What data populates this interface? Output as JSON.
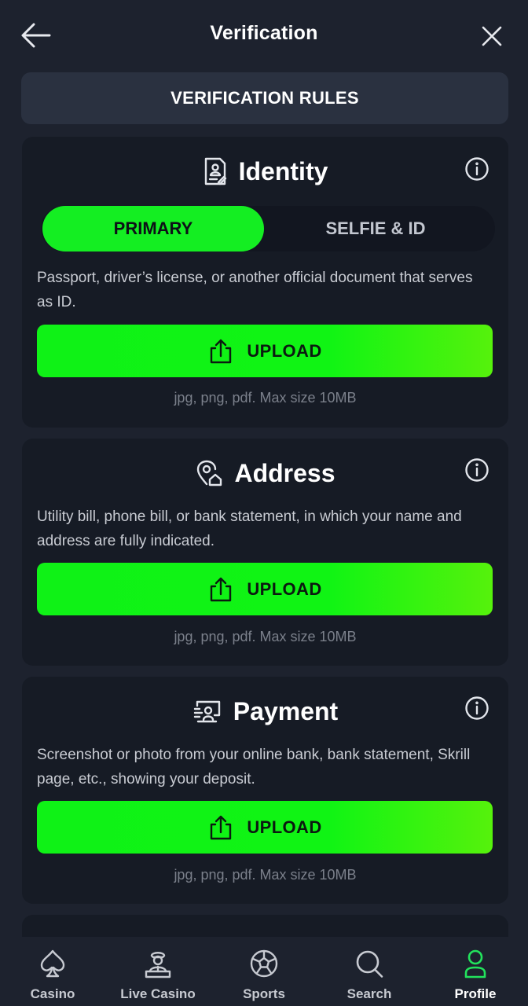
{
  "header": {
    "title": "Verification",
    "back_icon": "arrow-left-icon",
    "close_icon": "close-icon"
  },
  "rules_button": {
    "label": "VERIFICATION RULES"
  },
  "sections": [
    {
      "title": "Identity",
      "icon": "id-document-icon",
      "tabs": [
        {
          "label": "PRIMARY",
          "active": true
        },
        {
          "label": "SELFIE & ID",
          "active": false
        }
      ],
      "description": "Passport, driver’s license, or another official document that serves as ID.",
      "upload_label": "UPLOAD",
      "hint": "jpg, png, pdf. Max size 10MB"
    },
    {
      "title": "Address",
      "icon": "location-home-icon",
      "description": "Utility bill, phone bill, or bank statement, in which your name and address are fully indicated.",
      "upload_label": "UPLOAD",
      "hint": "jpg, png, pdf. Max size 10MB"
    },
    {
      "title": "Payment",
      "icon": "payment-card-icon",
      "description": "Screenshot or photo from your online bank, bank statement, Skrill page, etc., showing your deposit.",
      "upload_label": "UPLOAD",
      "hint": "jpg, png, pdf. Max size 10MB"
    }
  ],
  "bottom_nav": [
    {
      "label": "Casino",
      "icon": "spade-icon",
      "active": false
    },
    {
      "label": "Live Casino",
      "icon": "dealer-icon",
      "active": false
    },
    {
      "label": "Sports",
      "icon": "soccer-ball-icon",
      "active": false
    },
    {
      "label": "Search",
      "icon": "search-icon",
      "active": false
    },
    {
      "label": "Profile",
      "icon": "profile-icon",
      "active": true
    }
  ],
  "colors": {
    "accent": "#14ee22",
    "background": "#1d222e",
    "card": "#161b25",
    "active_nav": "#22e35c"
  }
}
